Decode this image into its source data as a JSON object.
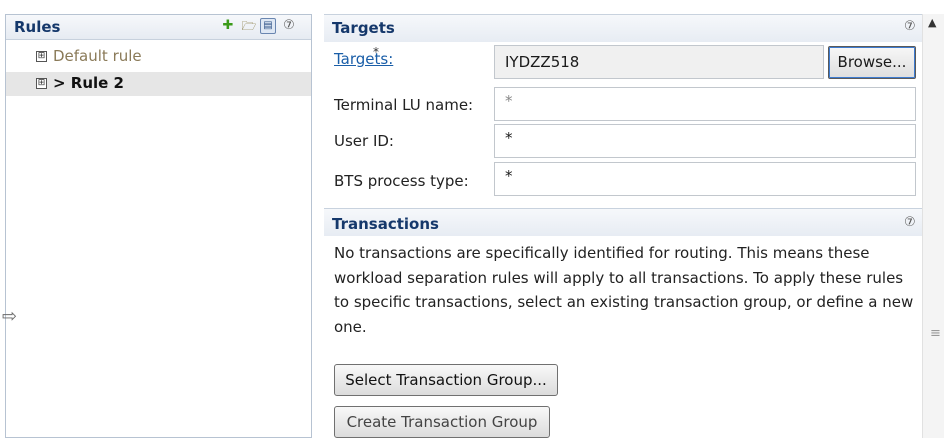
{
  "rules_panel": {
    "title": "Rules",
    "toolbar": {
      "add_icon": "plus-icon",
      "import_icon": "folder-icon",
      "toggle_icon": "toggle-view-icon",
      "help_icon": "help-icon"
    },
    "items": [
      {
        "label": "Default rule",
        "expander": "⊞",
        "selected": false
      },
      {
        "label": "> Rule 2",
        "expander": "⊞",
        "selected": true
      }
    ]
  },
  "targets": {
    "title": "Targets",
    "targets_link": "Targets:",
    "required_marker": "*",
    "targets_value": "IYDZZ518",
    "browse_label": "Browse...",
    "terminal_lu_label": "Terminal LU name:",
    "terminal_lu_value": "*",
    "user_id_label": "User ID:",
    "user_id_value": "*",
    "bts_label": "BTS process type:",
    "bts_value": "*"
  },
  "transactions": {
    "title": "Transactions",
    "description": "No transactions are specifically identified for routing.  This means these workload separation rules will apply to all transactions.  To apply these rules to specific transactions, select an existing transaction group, or define a new one.",
    "select_group_label": "Select Transaction Group...",
    "create_group_label": "Create Transaction Group"
  },
  "icons": {
    "help": "?",
    "sash_arrow": "⇨",
    "scroll_up": "▲",
    "scroll_grip": "≡"
  },
  "colors": {
    "header_title": "#15386b",
    "link": "#1a5ea8",
    "selection": "#e6e6e6"
  }
}
